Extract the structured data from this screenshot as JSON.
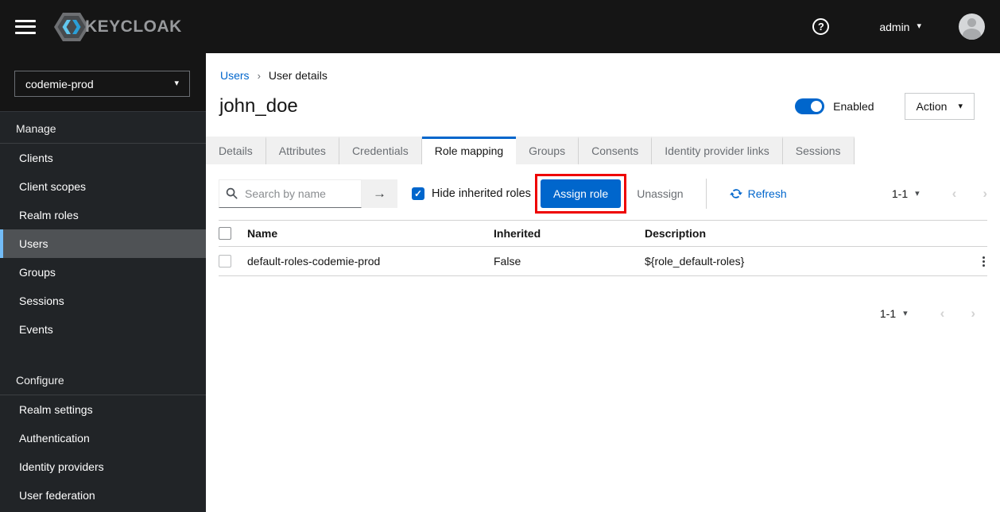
{
  "topbar": {
    "brand": "KEYCLOAK",
    "username": "admin"
  },
  "sidebar": {
    "realm": "codemie-prod",
    "sections": [
      {
        "label": "Manage",
        "items": [
          "Clients",
          "Client scopes",
          "Realm roles",
          "Users",
          "Groups",
          "Sessions",
          "Events"
        ]
      },
      {
        "label": "Configure",
        "items": [
          "Realm settings",
          "Authentication",
          "Identity providers",
          "User federation"
        ]
      }
    ],
    "selected_item": "Users"
  },
  "breadcrumb": {
    "link": "Users",
    "current": "User details"
  },
  "page": {
    "title": "john_doe",
    "enabled_label": "Enabled",
    "action_label": "Action"
  },
  "tabs": {
    "items": [
      "Details",
      "Attributes",
      "Credentials",
      "Role mapping",
      "Groups",
      "Consents",
      "Identity provider links",
      "Sessions"
    ],
    "active": "Role mapping"
  },
  "toolbar": {
    "search_placeholder": "Search by name",
    "hide_inherited_label": "Hide inherited roles",
    "hide_inherited_checked": true,
    "assign_label": "Assign role",
    "unassign_label": "Unassign",
    "refresh_label": "Refresh",
    "pagination_range": "1-1"
  },
  "table": {
    "columns": [
      "Name",
      "Inherited",
      "Description"
    ],
    "rows": [
      {
        "name": "default-roles-codemie-prod",
        "inherited": "False",
        "description": "${role_default-roles}"
      }
    ]
  },
  "footer": {
    "pagination_range": "1-1"
  },
  "icons": {
    "hamburger": "three-bars",
    "help": "?",
    "caret_down": "▾",
    "search": "magnifier",
    "arrow_right": "→",
    "check": "✓",
    "refresh": "sync-arrows",
    "kebab": "⋮",
    "chevron_left": "‹",
    "chevron_right": "›",
    "breadcrumb_sep": "›"
  },
  "colors": {
    "primary": "#0066cc",
    "annotation_highlight": "#ee0000",
    "topbar_bg": "#151515",
    "sidebar_bg": "#212427",
    "nav_selected_bg": "#4f5255",
    "nav_selected_accent": "#73bcf7",
    "tab_inactive_bg": "#f0f0f0",
    "muted_text": "#6a6e73",
    "border": "#d2d2d2"
  }
}
